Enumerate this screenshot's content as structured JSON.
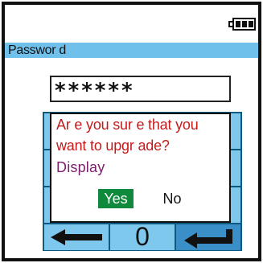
{
  "header": {
    "title": "Passwor d"
  },
  "password": {
    "masked_value": "******"
  },
  "dialog": {
    "message_line_1": "Ar e you sur e that you",
    "message_line_2": "want to upgr ade?",
    "message_line_3": "Display",
    "yes_label": "Yes",
    "no_label": "No"
  },
  "keypad": {
    "zero_label": "0"
  },
  "icons": {
    "battery": "battery-full-icon",
    "back": "arrow-left-icon",
    "enter": "enter-icon"
  },
  "colors": {
    "title_bar": "#6fc0ea",
    "keypad_key": "#7ec8ee",
    "yes_button": "#0f8a3c",
    "message_text": "#c41b1b",
    "option_text": "#7a1f6c"
  }
}
